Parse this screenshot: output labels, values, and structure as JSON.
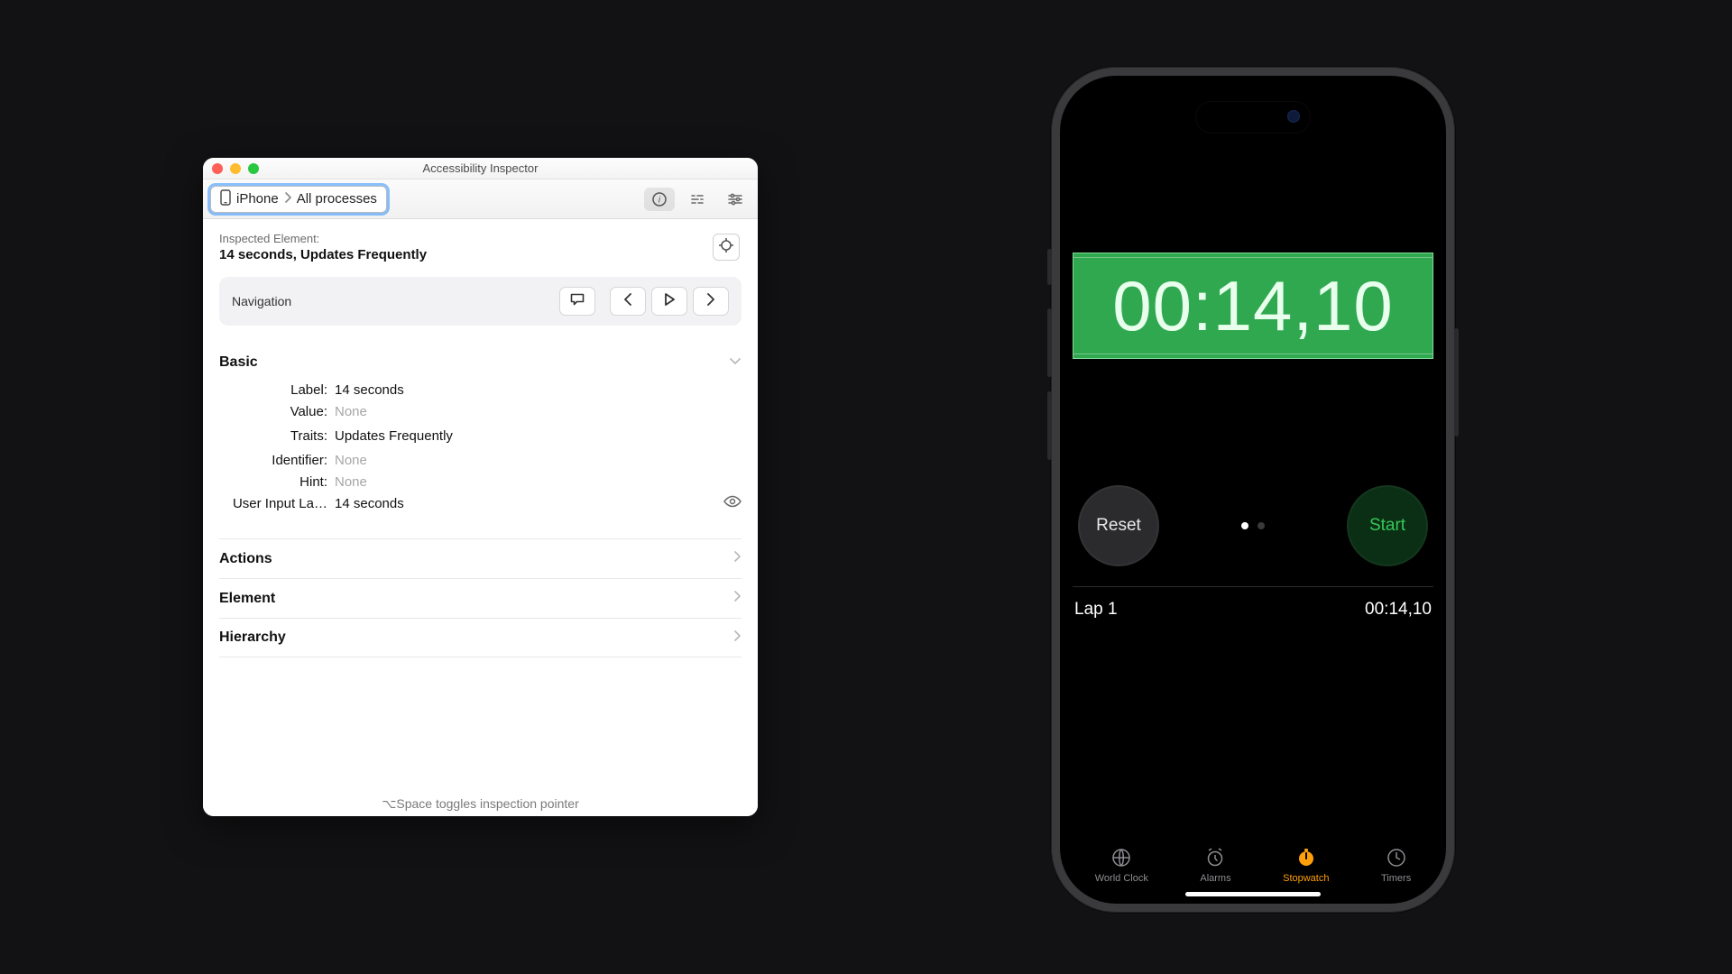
{
  "inspector": {
    "window_title": "Accessibility Inspector",
    "target": {
      "device": "iPhone",
      "process": "All processes"
    },
    "inspected_element": {
      "label_text": "Inspected Element:",
      "summary": "14 seconds, Updates Frequently"
    },
    "navigation": {
      "title": "Navigation"
    },
    "basic": {
      "title": "Basic",
      "rows": {
        "label": {
          "key": "Label:",
          "val": "14 seconds",
          "muted": false
        },
        "value": {
          "key": "Value:",
          "val": "None",
          "muted": true
        },
        "traits": {
          "key": "Traits:",
          "val": "Updates Frequently",
          "muted": false
        },
        "identifier": {
          "key": "Identifier:",
          "val": "None",
          "muted": true
        },
        "hint": {
          "key": "Hint:",
          "val": "None",
          "muted": true
        },
        "user_input_label": {
          "key": "User Input La…",
          "val": "14 seconds",
          "muted": false
        }
      }
    },
    "sections": {
      "actions": "Actions",
      "element": "Element",
      "hierarchy": "Hierarchy"
    },
    "footer_hint": "⌥Space toggles inspection pointer"
  },
  "phone": {
    "timer_display": "00:14,10",
    "reset_label": "Reset",
    "start_label": "Start",
    "lap": {
      "name": "Lap 1",
      "time": "00:14,10"
    },
    "tabs": {
      "world_clock": "World Clock",
      "alarms": "Alarms",
      "stopwatch": "Stopwatch",
      "timers": "Timers",
      "active": "stopwatch"
    }
  }
}
